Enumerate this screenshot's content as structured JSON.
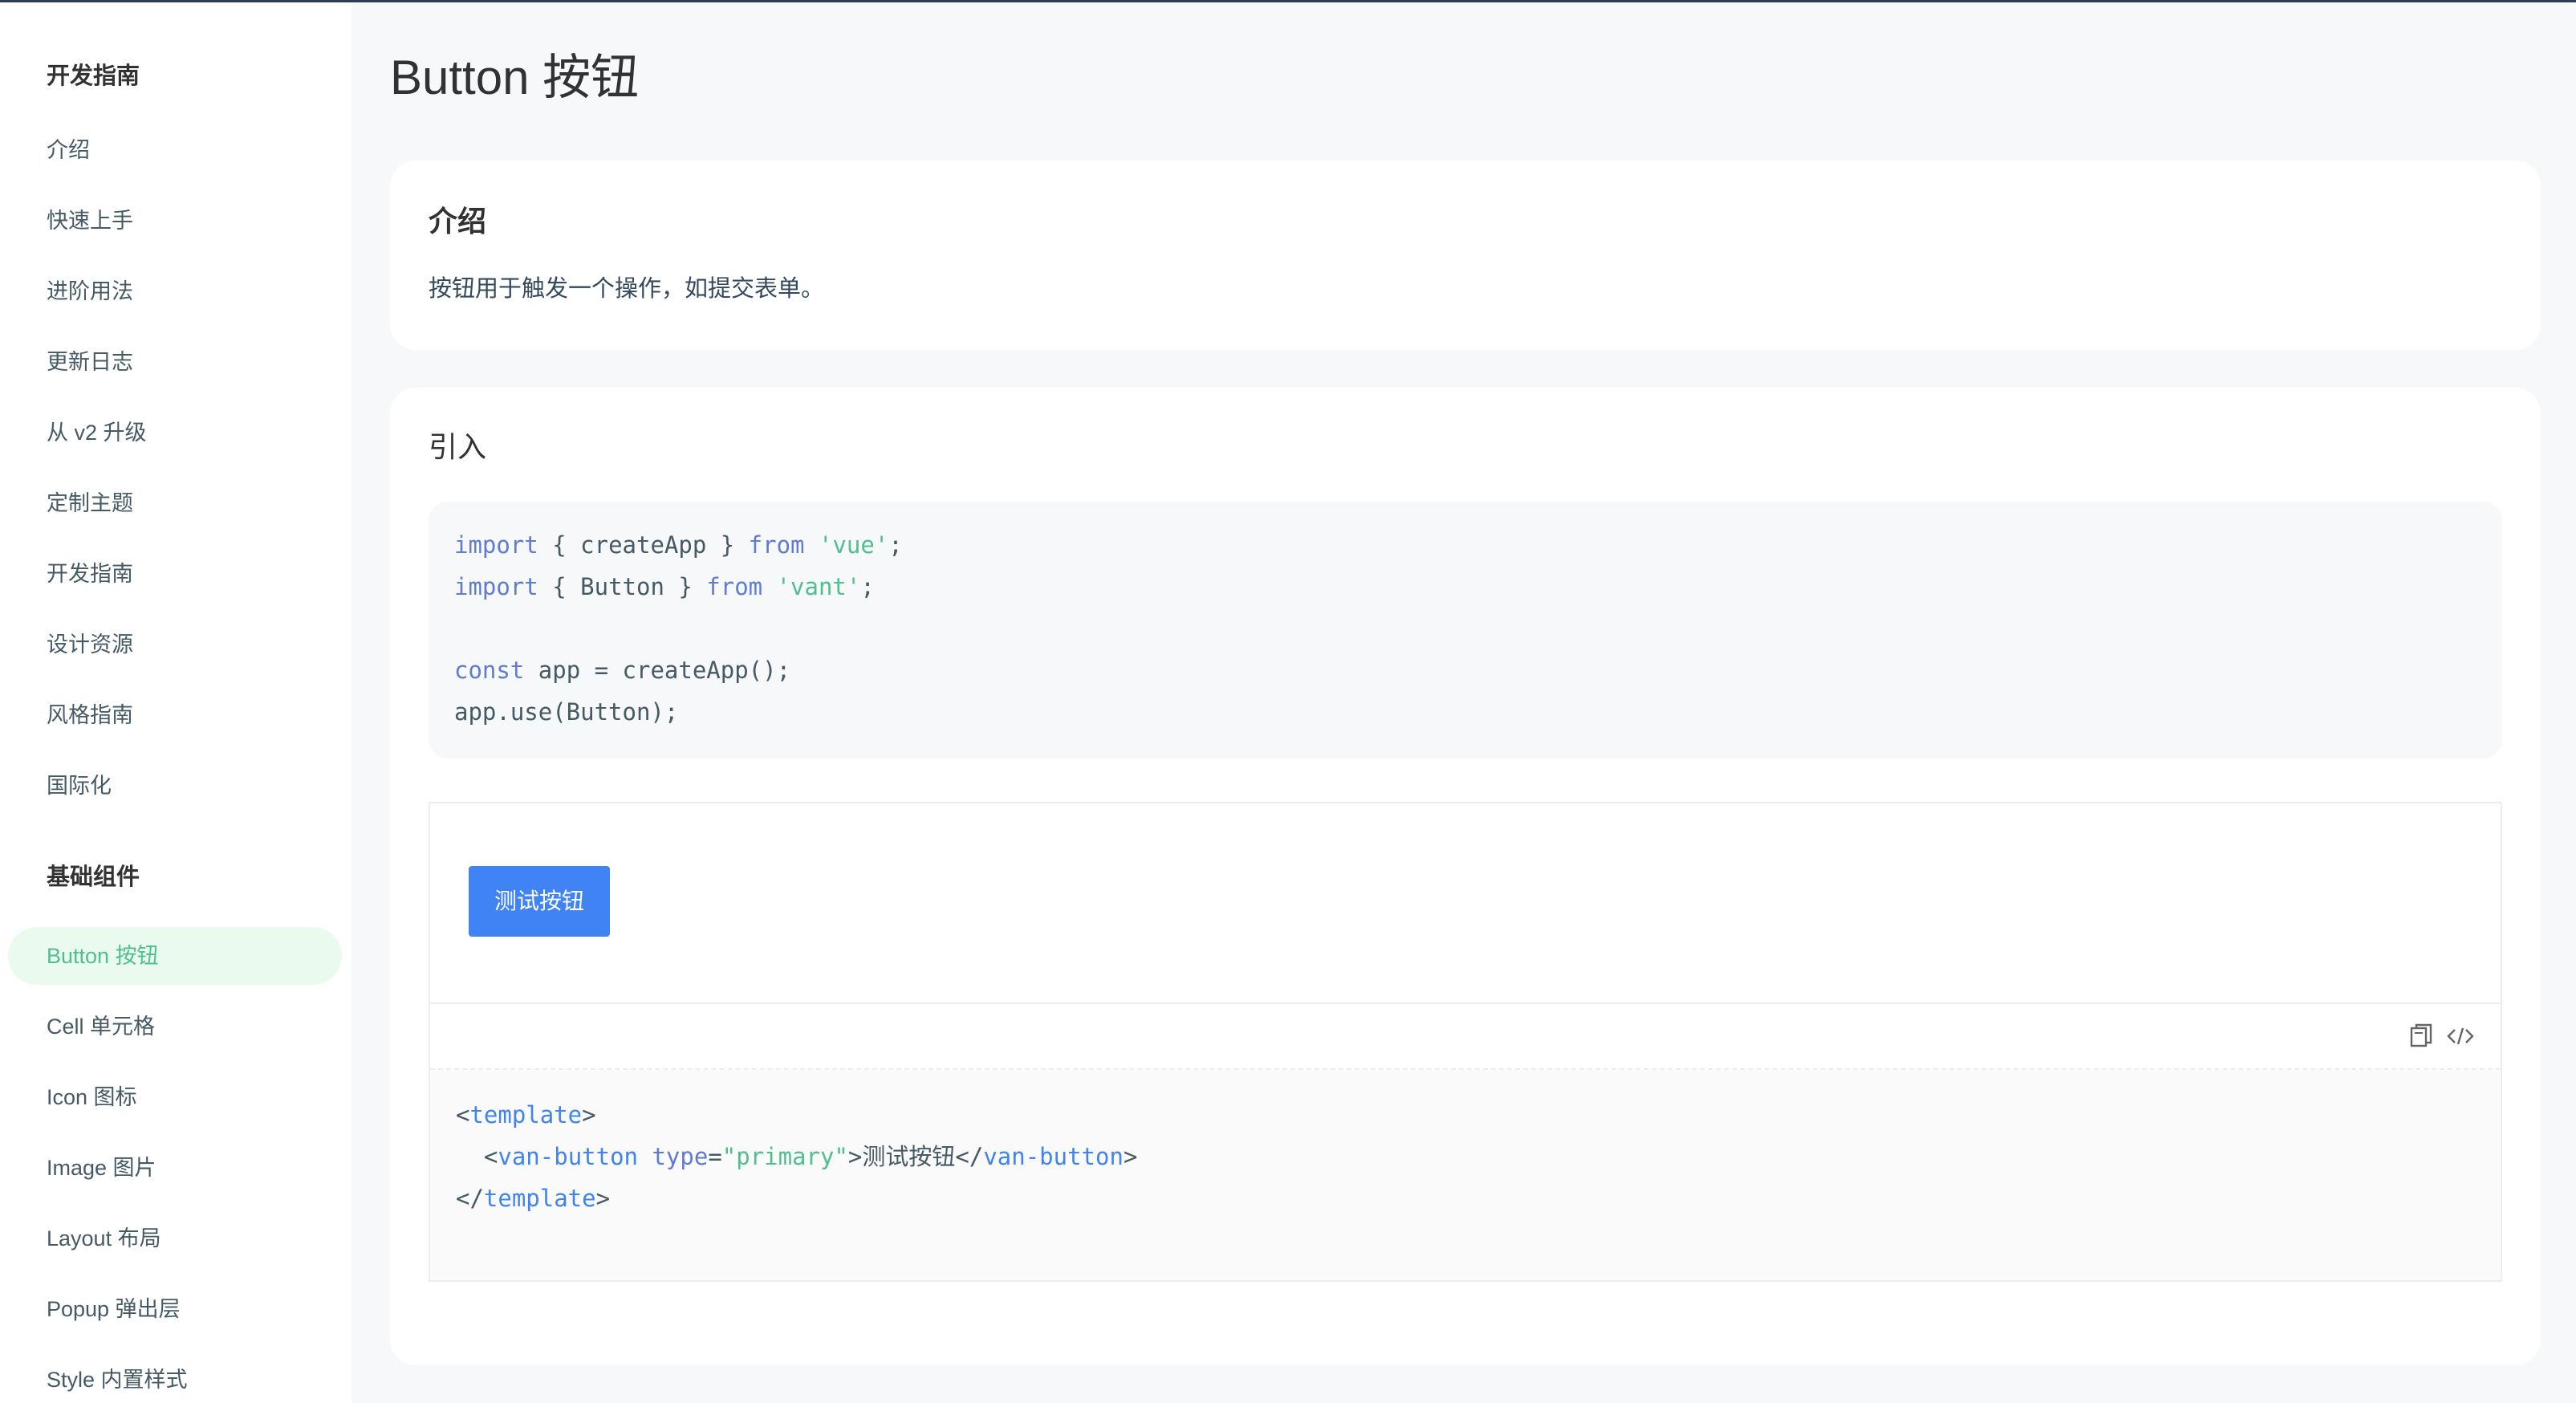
{
  "sidebar": {
    "groups": [
      {
        "title": "开发指南",
        "items": [
          "介绍",
          "快速上手",
          "进阶用法",
          "更新日志",
          "从 v2 升级",
          "定制主题",
          "开发指南",
          "设计资源",
          "风格指南",
          "国际化"
        ]
      },
      {
        "title": "基础组件",
        "items": [
          "Button 按钮",
          "Cell 单元格",
          "Icon 图标",
          "Image 图片",
          "Layout 布局",
          "Popup 弹出层",
          "Style 内置样式"
        ]
      }
    ],
    "active_item": "Button 按钮"
  },
  "page": {
    "title": "Button 按钮"
  },
  "intro": {
    "title": "介绍",
    "text": "按钮用于触发一个操作，如提交表单。"
  },
  "import_section": {
    "title": "引入",
    "code": {
      "l1_kw": "import",
      "l1_mid": " { createApp } ",
      "l1_from": "from",
      "l1_str": "'vue'",
      "l1_end": ";",
      "l2_kw": "import",
      "l2_mid": " { Button } ",
      "l2_from": "from",
      "l2_str": "'vant'",
      "l2_end": ";",
      "l4_kw": "const",
      "l4_rest": " app = createApp();",
      "l5": "app.use(Button);"
    }
  },
  "demo": {
    "button_label": "测试按钮",
    "copy_icon": "copy-icon",
    "code_icon": "code-toggle-icon",
    "code": {
      "l1_open": "<",
      "l1_tag": "template",
      "l1_close": ">",
      "l2_indent": "  <",
      "l2_tag": "van-button",
      "l2_attr": " type",
      "l2_eq": "=",
      "l2_val": "\"primary\"",
      "l2_gt": ">",
      "l2_text": "测试按钮",
      "l2_endopen": "</",
      "l2_endtag": "van-button",
      "l2_endgt": ">",
      "l3_open": "</",
      "l3_tag": "template",
      "l3_close": ">"
    }
  },
  "colors": {
    "accent": "#4fc08d",
    "primary_button": "#3f83f5",
    "active_bg": "#ebfaef"
  }
}
